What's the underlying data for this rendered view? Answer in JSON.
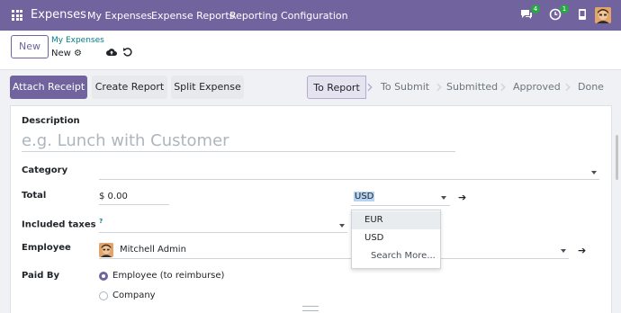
{
  "navbar": {
    "app_name": "Expenses",
    "menu": [
      "My Expenses",
      "Expense Reports",
      "Reporting",
      "Configuration"
    ],
    "messages_badge": "4",
    "activities_badge": "1",
    "icons": [
      "apps-grid-icon",
      "chat-icon",
      "clock-icon",
      "phone-icon",
      "user-avatar"
    ]
  },
  "control": {
    "new_label": "New",
    "breadcrumb": "My Expenses",
    "record_name": "New"
  },
  "actions": {
    "attach_receipt": "Attach Receipt",
    "create_report": "Create Report",
    "split_expense": "Split Expense"
  },
  "status": {
    "stages": [
      "To Report",
      "To Submit",
      "Submitted",
      "Approved",
      "Done"
    ],
    "active": "To Report"
  },
  "form": {
    "description_label": "Description",
    "description_placeholder": "e.g. Lunch with Customer",
    "category_label": "Category",
    "total_label": "Total",
    "total_value": "$ 0.00",
    "currency_value": "USD",
    "included_taxes_label": "Included taxes",
    "included_taxes_help": "?",
    "employee_label": "Employee",
    "employee_value": "Mitchell Admin",
    "paid_by_label": "Paid By",
    "paid_by_options": [
      "Employee (to reimburse)",
      "Company"
    ],
    "paid_by_selected": "Employee (to reimburse)"
  },
  "currency_dropdown": {
    "options": [
      "EUR",
      "USD"
    ],
    "highlighted": "EUR",
    "search_more": "Search More..."
  },
  "colors": {
    "brand": "#71639e",
    "link": "#017e84",
    "badge": "#28a745"
  }
}
